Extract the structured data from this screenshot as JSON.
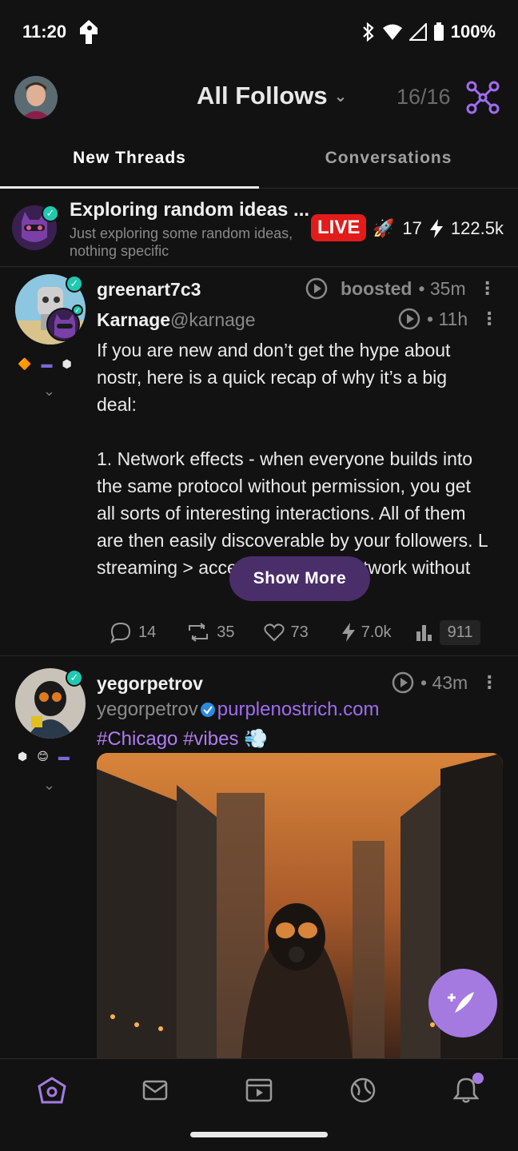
{
  "status_bar": {
    "time": "11:20",
    "battery": "100%"
  },
  "header": {
    "feed_title": "All Follows",
    "relay_count": "16/16"
  },
  "tabs": [
    {
      "label": "New Threads",
      "active": true
    },
    {
      "label": "Conversations",
      "active": false
    }
  ],
  "live": {
    "title": "Exploring random ideas ...",
    "subtitle": "Just exploring some random ideas, nothing specific",
    "badge": "LIVE",
    "boosts": "17",
    "zaps": "122.5k"
  },
  "post1": {
    "booster": "greenart7c3",
    "boost_meta": "boosted",
    "boost_time": "• 35m",
    "author": "Karnage",
    "handle": "@karnage",
    "time": "• 11h",
    "text": "If you are new and don’t get the hype about nostr, here is a quick recap of why it’s a big deal:\n\n1. Network effects - when everyone builds into the same protocol without permission, you get all sorts of interesting interactions. All of them are then easily discoverable by your followers. L                  streaming > access the entire network without",
    "show_more": "Show More",
    "replies": "14",
    "reposts": "35",
    "likes": "73",
    "zaps": "7.0k",
    "views": "911"
  },
  "post2": {
    "author": "yegorpetrov",
    "time": "• 43m",
    "nip05_user": "yegorpetrov",
    "nip05_domain": "purplenostrich.com",
    "hashtags": "#Chicago #vibes 💨"
  },
  "colors": {
    "accent": "#a57ae0",
    "live": "#e21b1b",
    "verified": "#1ec9b0"
  }
}
